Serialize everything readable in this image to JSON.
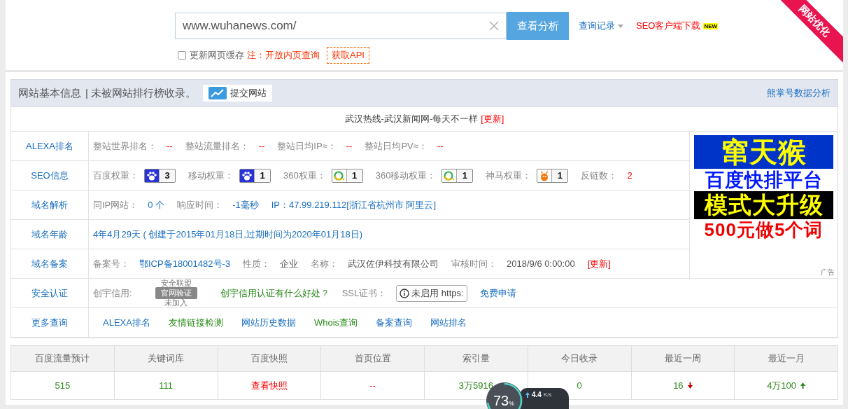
{
  "search": {
    "value": "www.wuhanews.com/",
    "button": "查看分析",
    "history_link": "查询记录",
    "download_link": "SEO客户端下载",
    "new_badge": "NEW",
    "cache_checkbox": {
      "label": "更新网页缓存",
      "checked": false
    },
    "note": "注：开放内页查询",
    "api_button": "获取API"
  },
  "corner_ribbon": "网站优化",
  "info_panel": {
    "title": "网站基本信息",
    "subtitle": "| 未被网站排行榜收录。",
    "submit_button": "提交网站",
    "right_link": "熊掌号数据分析",
    "site_title": "武汉热线-武汉新闻网-每天不一样",
    "update_link": "[更新]",
    "rows": [
      {
        "label": "ALEXA排名",
        "items": [
          {
            "kind": "metric",
            "label": "整站世界排名：",
            "value": "--"
          },
          {
            "kind": "metric",
            "label": "整站流量排名：",
            "value": "--"
          },
          {
            "kind": "metric",
            "label": "整站日均IP≈：",
            "value": "--"
          },
          {
            "kind": "metric",
            "label": "整站日均PV≈：",
            "value": "--"
          }
        ]
      },
      {
        "label": "SEO信息",
        "items": [
          {
            "kind": "paw",
            "label": "百度权重：",
            "value": "3"
          },
          {
            "kind": "paw",
            "label": "移动权重：",
            "value": "1"
          },
          {
            "kind": "ring",
            "label": "360权重：",
            "value": "1"
          },
          {
            "kind": "ring",
            "label": "360移动权重：",
            "value": "1"
          },
          {
            "kind": "horse",
            "label": "神马权重：",
            "value": "1"
          },
          {
            "kind": "metric",
            "label": "反链数：",
            "value": "2"
          }
        ]
      },
      {
        "label": "域名解析",
        "items": [
          {
            "kind": "stat",
            "label": "同IP网站：",
            "value": "0 个"
          },
          {
            "kind": "stat",
            "label": "响应时间：",
            "value": "-1毫秒"
          },
          {
            "kind": "info",
            "text": "IP：47.99.219.112[浙江省杭州市 阿里云]"
          }
        ]
      },
      {
        "label": "域名年龄",
        "items": [
          {
            "kind": "info",
            "text": "4年4月29天 ( 创建于2015年01月18日,过期时间为2020年01月18日)"
          }
        ]
      },
      {
        "label": "域名备案",
        "items": [
          {
            "kind": "stat",
            "label": "备案号：",
            "value": "鄂ICP备18001482号-3"
          },
          {
            "kind": "fact",
            "label": "性质：",
            "value": "企业"
          },
          {
            "kind": "fact",
            "label": "名称：",
            "value": "武汉佐伊科技有限公司"
          },
          {
            "kind": "fact",
            "label": "审核时间：",
            "value": "2018/9/6 0:00:00"
          },
          {
            "kind": "update",
            "text": "[更新]"
          }
        ]
      },
      {
        "label": "安全认证",
        "items": [
          {
            "kind": "seal",
            "label": "创宇信用:",
            "top": "安全联盟",
            "main": "官网验证",
            "bottom": "未加入"
          },
          {
            "kind": "promo",
            "text": "创宇信用认证有什么好处？"
          },
          {
            "kind": "ssl",
            "label": "SSL证书：",
            "value": "未启用 https:"
          },
          {
            "kind": "link",
            "text": "免费申请"
          }
        ]
      },
      {
        "label": "更多查询",
        "items": [
          {
            "kind": "link",
            "text": "ALEXA排名"
          },
          {
            "kind": "promo",
            "text": "友情链接检测"
          },
          {
            "kind": "link",
            "text": "网站历史数据"
          },
          {
            "kind": "promo",
            "text": "Whois查询"
          },
          {
            "kind": "link",
            "text": "备案查询"
          },
          {
            "kind": "link",
            "text": "网站排名"
          }
        ]
      }
    ],
    "ad": {
      "lines": [
        "窜天猴",
        "百度快排平台",
        "模式大升级",
        "500元做5个词"
      ],
      "caption": "广告"
    }
  },
  "stats": {
    "columns": [
      "百度流量预计",
      "关键词库",
      "百度快照",
      "首页位置",
      "索引量",
      "今日收录",
      "最近一周",
      "最近一月"
    ],
    "values": [
      {
        "kind": "figure",
        "text": "515"
      },
      {
        "kind": "figure",
        "text": "111"
      },
      {
        "kind": "action",
        "text": "查看快照"
      },
      {
        "kind": "empty",
        "text": "--"
      },
      {
        "kind": "figure",
        "text": "3万5916"
      },
      {
        "kind": "figure",
        "text": "0"
      },
      {
        "kind": "falling",
        "text": "16"
      },
      {
        "kind": "rising",
        "text": "4万100"
      }
    ]
  },
  "speed_widget": {
    "percent": "73",
    "percent_unit": "%",
    "speed": "4.4",
    "speed_unit": "K/s"
  }
}
